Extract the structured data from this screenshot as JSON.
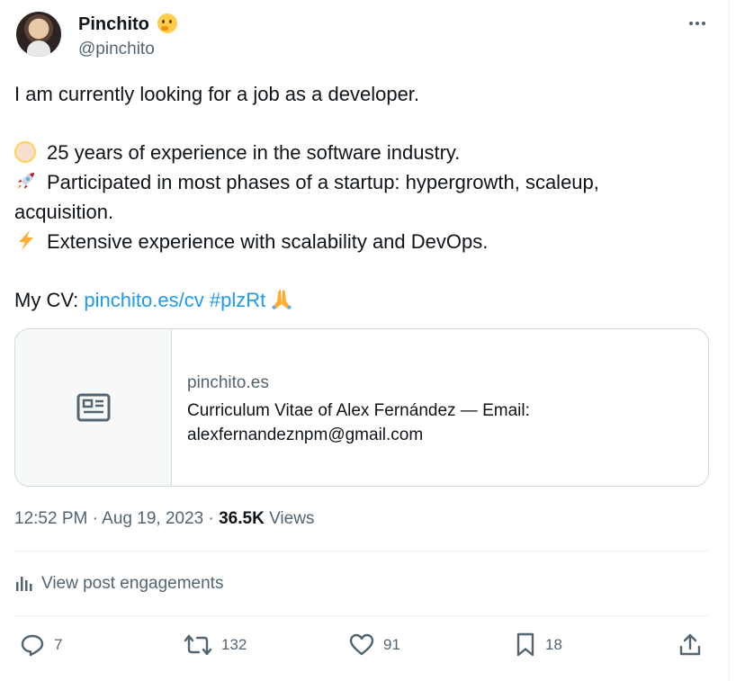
{
  "user": {
    "display_name": "Pinchito",
    "name_emoji": "thinking-face",
    "handle": "@pinchito"
  },
  "tweet": {
    "intro": "I am currently looking for a job as a developer.",
    "points": [
      {
        "emoji": "older-person",
        "text": "25 years of experience in the software industry."
      },
      {
        "emoji": "rocket",
        "text": "Participated in most phases of a startup: hypergrowth, scaleup,",
        "continuation": "acquisition."
      },
      {
        "emoji": "high-voltage",
        "text": "Extensive experience with scalability and DevOps."
      }
    ],
    "cv_prefix": "My CV:",
    "cv_link": "pinchito.es/cv",
    "hashtag": "#plzRt",
    "closing_emoji": "folded-hands"
  },
  "card": {
    "icon": "article-icon",
    "domain": "pinchito.es",
    "description": "Curriculum Vitae of Alex Fernández — Email: alexfernandeznpm@gmail.com"
  },
  "meta": {
    "time": "12:52 PM",
    "separator": "·",
    "date": "Aug 19, 2023",
    "views_count": "36.5K",
    "views_label": "Views"
  },
  "engagements": {
    "label": "View post engagements",
    "icon": "chart-bars-icon"
  },
  "actions": {
    "replies": "7",
    "reposts": "132",
    "likes": "91",
    "bookmarks": "18"
  },
  "colors": {
    "accent": "#1d9bf0",
    "secondary_text": "#536471",
    "primary_text": "#0f1419",
    "border": "#cfd9de"
  }
}
